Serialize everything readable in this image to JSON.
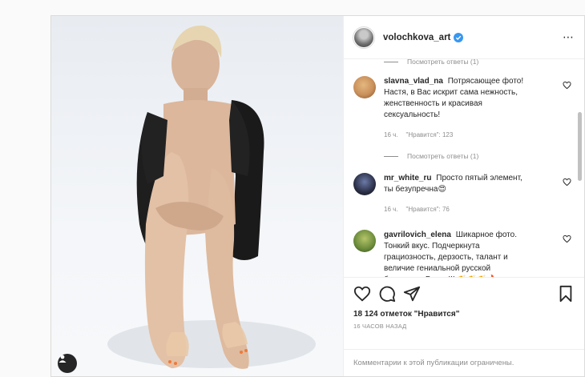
{
  "post": {
    "username": "volochkova_art",
    "more_icon": "⋯"
  },
  "comments": {
    "reply_top": "Посмотреть ответы (1)",
    "items": [
      {
        "user": "slavna_vlad_na",
        "text": "Потрясающее фото! Настя, в Вас искрит сама нежность, женственность и красивая сексуальность!",
        "time": "16 ч.",
        "likes": "\"Нравится\": 123",
        "replies": "Посмотреть ответы (1)",
        "avatar_color": "#c98f5a"
      },
      {
        "user": "mr_white_ru",
        "text": "Просто пятый элемент, ты безупречна😍",
        "time": "16 ч.",
        "likes": "\"Нравится\": 76",
        "replies": "",
        "avatar_color": "#2a2f45"
      },
      {
        "user": "gavrilovich_elena",
        "text": "Шикарное фото. Тонкий вкус. Подчеркнута грациозность, дерзость, талант и величие гениальной русской балерины. Браво!!! 👏👏👏🔥",
        "time": "",
        "likes": "",
        "replies": "",
        "avatar_color": "#6a8a3a"
      }
    ]
  },
  "actions": {
    "likes": "18 124 отметок \"Нравится\"",
    "time": "16 ЧАСОВ НАЗАД"
  },
  "footer": {
    "text": "Комментарии к этой публикации ограничены."
  },
  "colors": {
    "verified": "#3897f0",
    "muted": "#8e8e8e",
    "text": "#262626"
  }
}
